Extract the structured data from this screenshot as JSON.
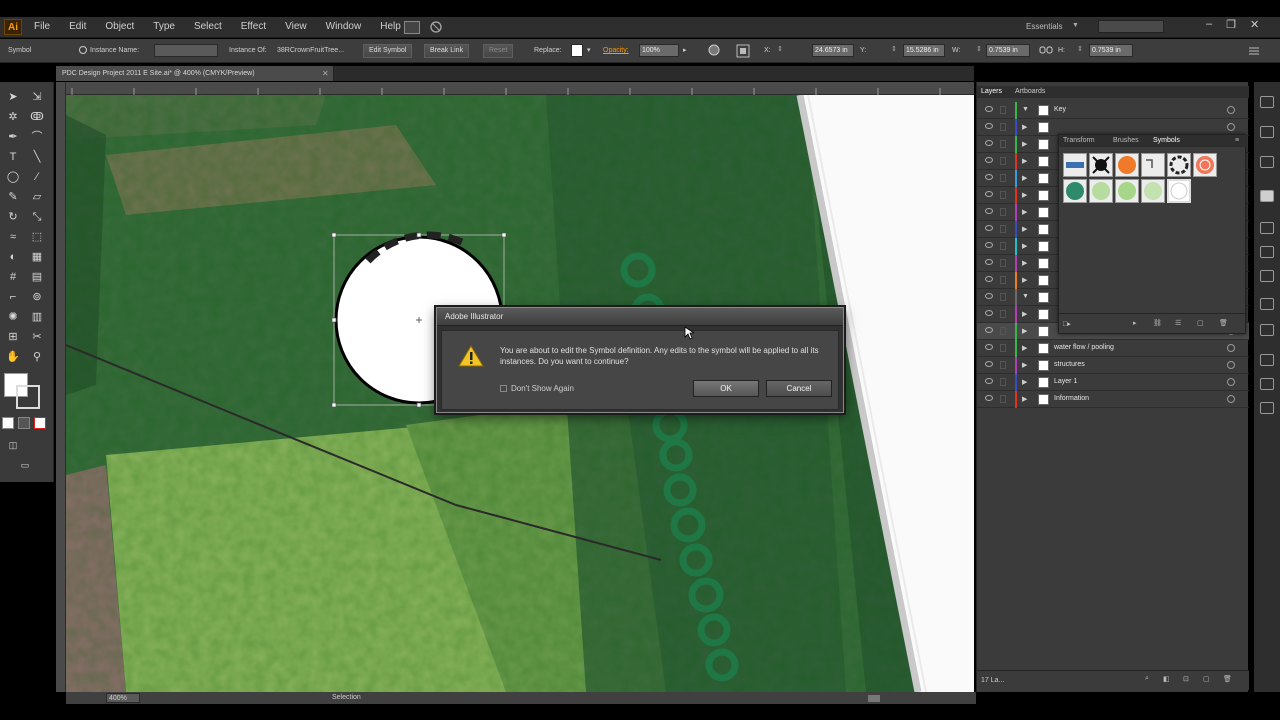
{
  "app": {
    "logo": "Ai"
  },
  "menubar": {
    "items": [
      "File",
      "Edit",
      "Object",
      "Type",
      "Select",
      "Effect",
      "View",
      "Window",
      "Help"
    ],
    "workspace": "Essentials",
    "window_controls": [
      "–",
      "❐",
      "✕"
    ]
  },
  "controlbar": {
    "selection_type": "Symbol",
    "instance_name_label": "Instance Name:",
    "instance_of_label": "Instance Of:",
    "instance_of_value": "38RCrownFruitTree...",
    "edit_symbol": "Edit Symbol",
    "break_link": "Break Link",
    "reset": "Reset",
    "replace_label": "Replace:",
    "opacity_label": "Opacity:",
    "opacity_value": "100%",
    "x_value": "24.6573 in",
    "y_value": "15.5286 in",
    "w_value": "0.7539 in",
    "h_value": "0.7539 in"
  },
  "document": {
    "tab_title": "PDC Design Project 2011 E Site.ai* @ 400% (CMYK/Preview)",
    "tab_close": "✕"
  },
  "statusbar": {
    "zoom": "400%",
    "status": "Selection"
  },
  "panel": {
    "tabs": [
      "Layers",
      "Artboards"
    ],
    "layers": [
      {
        "name": "Key",
        "color": "#3ab54a",
        "expanded": true
      },
      {
        "name": "",
        "color": "#3b4cc0",
        "expanded": false
      },
      {
        "name": "",
        "color": "#3ab54a",
        "expanded": false
      },
      {
        "name": "",
        "color": "#e0341e",
        "expanded": false
      },
      {
        "name": "",
        "color": "#3a9bd9",
        "expanded": false
      },
      {
        "name": "",
        "color": "#e0341e",
        "expanded": false
      },
      {
        "name": "",
        "color": "#b03fb5",
        "expanded": false
      },
      {
        "name": "",
        "color": "#3b4cc0",
        "expanded": false
      },
      {
        "name": "",
        "color": "#1ec0c6",
        "expanded": false
      },
      {
        "name": "",
        "color": "#b03fb5",
        "expanded": false
      },
      {
        "name": "",
        "color": "#f07a1f",
        "expanded": false
      },
      {
        "name": "",
        "color": "#6c6c6c",
        "expanded": true
      },
      {
        "name": "",
        "color": "#b03fb5",
        "expanded": false
      },
      {
        "name": "",
        "color": "#3ab54a",
        "expanded": false
      },
      {
        "name": "water flow / pooling",
        "color": "#3ab54a",
        "expanded": false
      },
      {
        "name": "structures",
        "color": "#b03fb5",
        "expanded": false
      },
      {
        "name": "Layer 1",
        "color": "#3b4cc0",
        "expanded": false
      },
      {
        "name": "Information",
        "color": "#e0341e",
        "expanded": false
      }
    ],
    "layers_count": "17 La..."
  },
  "symbols_panel": {
    "tabs": [
      "Transform",
      "Brushes",
      "Symbols"
    ],
    "view_label": "□▸"
  },
  "dialog": {
    "title": "Adobe Illustrator",
    "message": "You are about to edit the Symbol definition. Any edits to the symbol will be applied to all its instances. Do you want to continue?",
    "dont_show": "Don't Show Again",
    "ok": "OK",
    "cancel": "Cancel"
  },
  "colors": {
    "accent": "#ff9a00",
    "canvas_green": "#2f5d38",
    "field_green": "#8fb75a",
    "path_green": "#1e7a48"
  }
}
